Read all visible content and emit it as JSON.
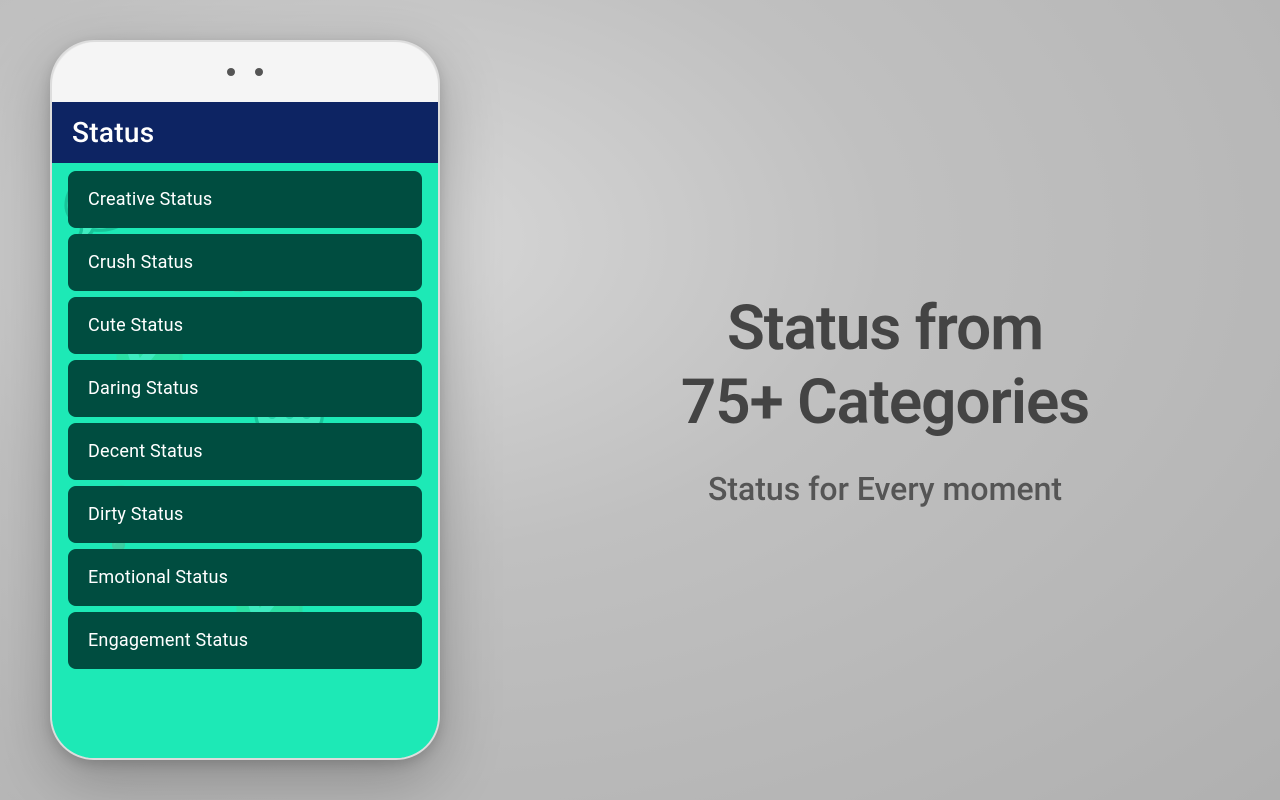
{
  "background": "#c8c8c8",
  "phone": {
    "header": {
      "title": "Status",
      "bg_color": "#0d2463"
    },
    "menu_items": [
      {
        "label": "Creative Status"
      },
      {
        "label": "Crush Status"
      },
      {
        "label": "Cute Status"
      },
      {
        "label": "Daring Status"
      },
      {
        "label": "Decent Status"
      },
      {
        "label": "Dirty Status"
      },
      {
        "label": "Emotional Status"
      },
      {
        "label": "Engagement Status"
      }
    ]
  },
  "right": {
    "headline": "Status from\n75+ Categories",
    "subheadline": "Status for Every moment"
  }
}
